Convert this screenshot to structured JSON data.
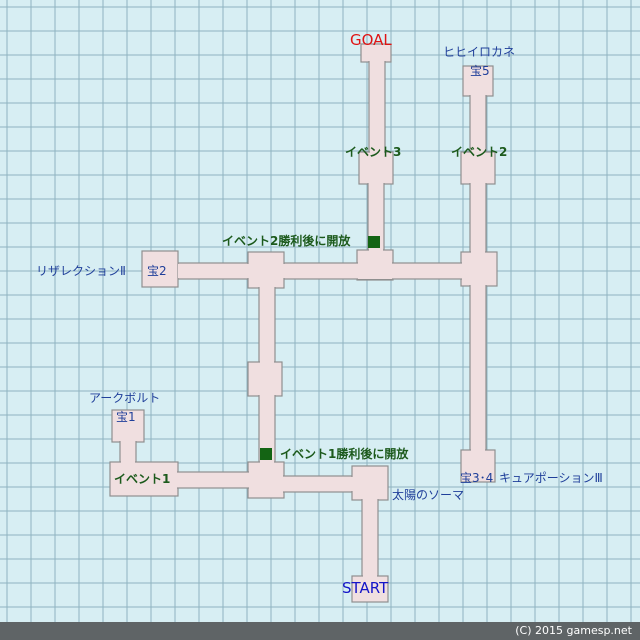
{
  "map": {
    "goal": "GOAL",
    "start": "START",
    "treasures": {
      "t1": "宝1",
      "t2": "宝2",
      "t34": "宝3･4",
      "t5": "宝5"
    },
    "items": {
      "arcbolt": "アークボルト",
      "resurrection": "リザレクションⅡ",
      "cure_potion": "キュアポーションⅢ",
      "hihiirokane": "ヒヒイロカネ",
      "sun_soma": "太陽のソーマ"
    },
    "events": {
      "e1": "イベント1",
      "e2": "イベント2",
      "e3": "イベント3"
    },
    "gates": {
      "after_e1": "イベント1勝利後に開放",
      "after_e2": "イベント2勝利後に開放"
    },
    "colors": {
      "background": "#d7eef3",
      "grid": "#8fb3c0",
      "floor": "#f0dfe0",
      "wall": "#8f8f8f",
      "gate": "#146414",
      "footer": "#5f6466"
    }
  },
  "footer": {
    "copyright": "(C) 2015 gamesp.net"
  }
}
